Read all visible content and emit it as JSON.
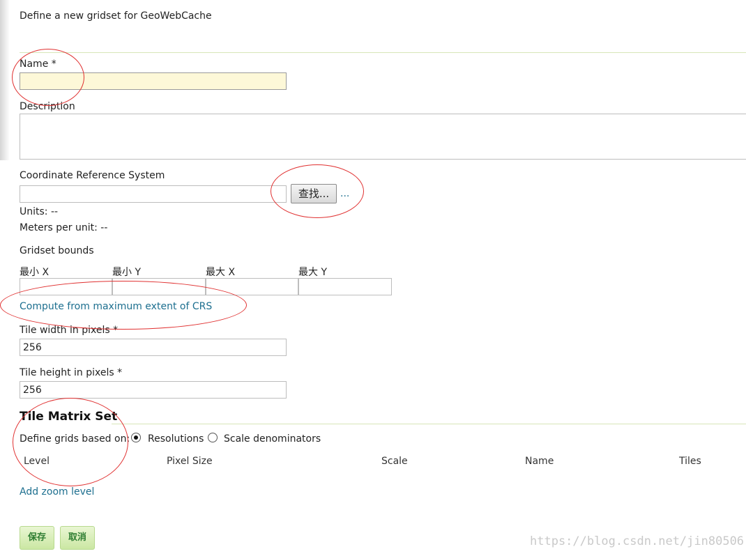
{
  "header": {
    "description": "Define a new gridset for GeoWebCache"
  },
  "form": {
    "name_label": "Name *",
    "name_value": "",
    "description_label": "Description",
    "description_value": "",
    "crs_label": "Coordinate Reference System",
    "crs_value": "",
    "find_button": "查找...",
    "crs_more_link": "...",
    "units": "Units: --",
    "meters_per_unit": "Meters per unit: --",
    "bounds_label": "Gridset bounds",
    "bounds_fields": [
      "最小 X",
      "最小 Y",
      "最大 X",
      "最大 Y"
    ],
    "bounds_values": [
      "",
      "",
      "",
      ""
    ],
    "compute_link": "Compute from maximum extent of CRS",
    "tile_width_label": "Tile width in pixels *",
    "tile_width_value": "256",
    "tile_height_label": "Tile height in pixels *",
    "tile_height_value": "256"
  },
  "tile_matrix": {
    "title": "Tile Matrix Set",
    "define_label": "Define grids based on:",
    "options": [
      "Resolutions",
      "Scale denominators"
    ],
    "selected": "Resolutions",
    "columns": [
      "Level",
      "Pixel Size",
      "Scale",
      "Name",
      "Tiles"
    ],
    "add_zoom_link": "Add zoom level"
  },
  "actions": {
    "save": "保存",
    "cancel": "取消"
  },
  "watermark": "https://blog.csdn.net/jin80506",
  "colors": {
    "accent_link": "#1d6f8f",
    "annotation": "#e03030",
    "button_green": "#cbe7a3"
  }
}
